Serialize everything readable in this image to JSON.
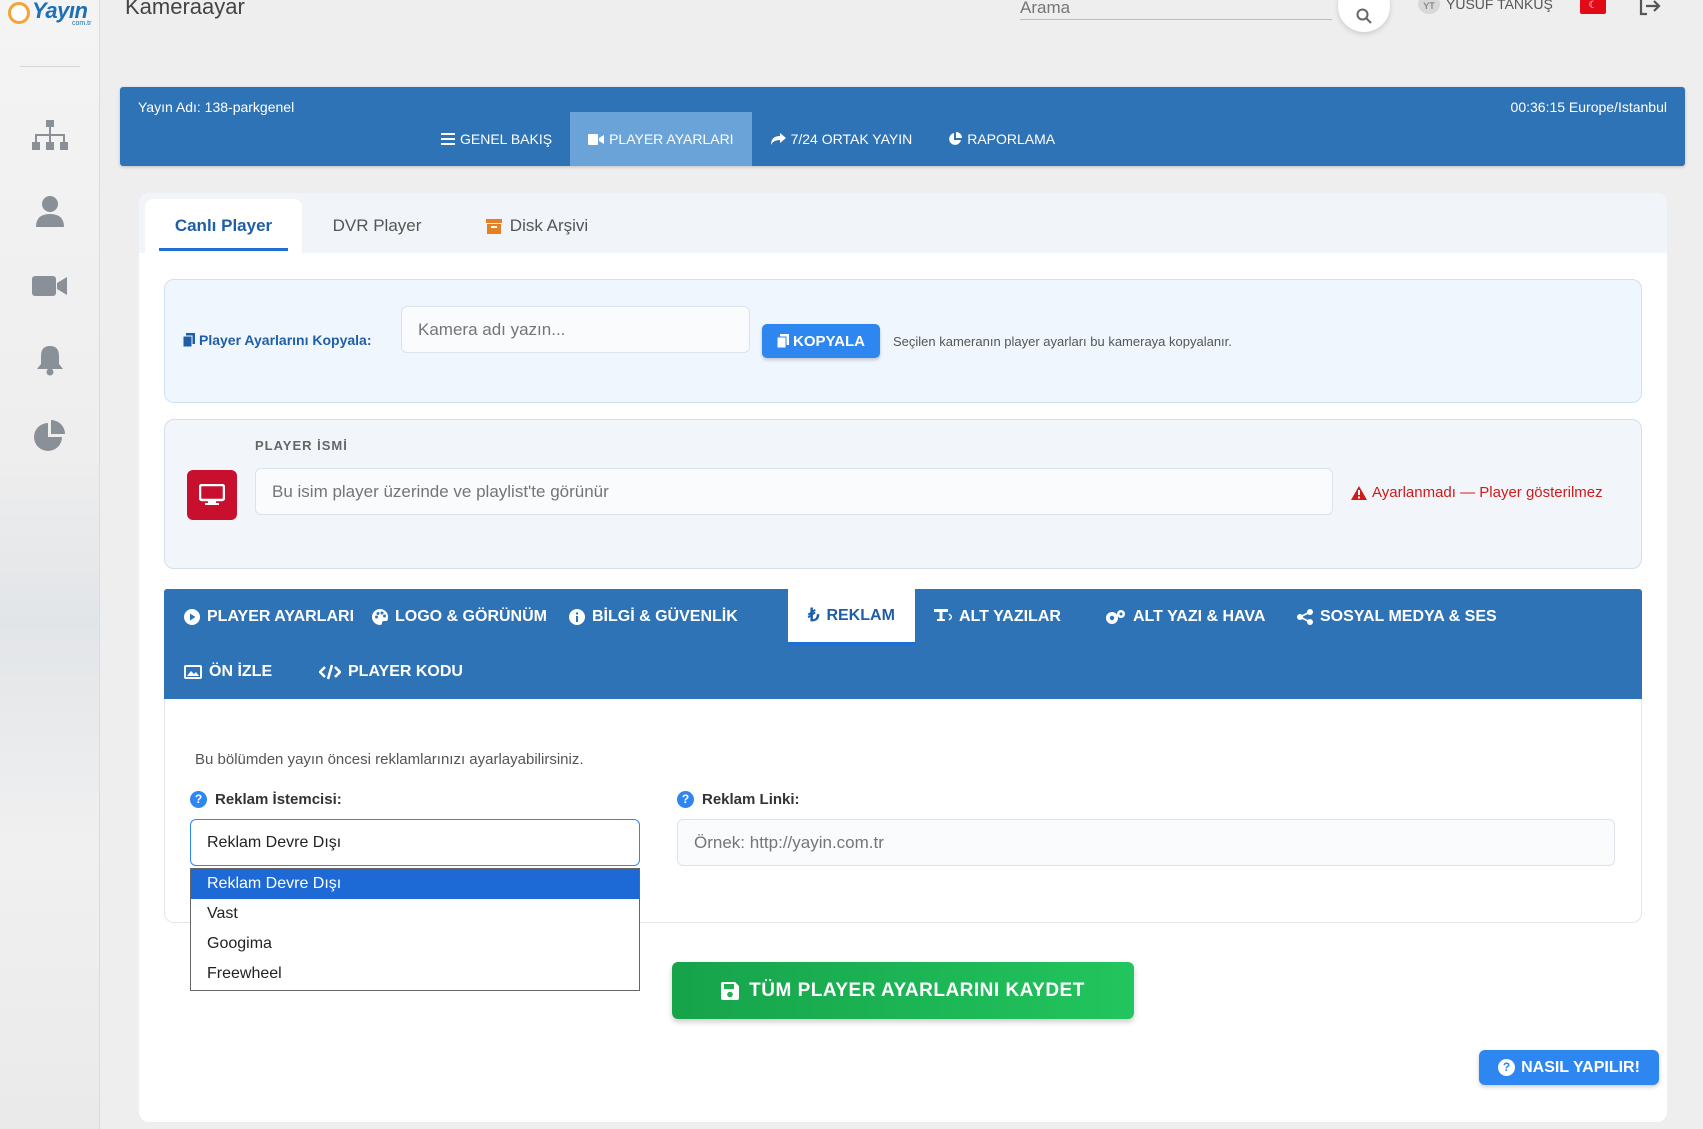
{
  "brand": {
    "name": "Yayın",
    "sub": "com.tr"
  },
  "header": {
    "title": "Kameraayar",
    "search_placeholder": "Arama",
    "avatar_initials": "YT",
    "user_name": "YUSUF TANKUŞ"
  },
  "stream": {
    "name": "Yayın Adı: 138-parkgenel",
    "time": "00:36:15 Europe/Istanbul"
  },
  "topnav": [
    "GENEL BAKIŞ",
    "PLAYER AYARLARI",
    "7/24 ORTAK YAYIN",
    "RAPORLAMA"
  ],
  "player_tabs": [
    "Canlı Player",
    "DVR Player",
    "Disk Arşivi"
  ],
  "copy": {
    "label": "Player Ayarlarını Kopyala:",
    "placeholder": "Kamera adı yazın...",
    "button": "KOPYALA",
    "help": "Seçilen kameranın player ayarları bu kameraya kopyalanır."
  },
  "player_name": {
    "label": "PLAYER İSMİ",
    "placeholder": "Bu isim player üzerinde ve playlist'te görünür",
    "warning": "Ayarlanmadı — Player gösterilmez"
  },
  "settings_tabs": [
    "PLAYER AYARLARI",
    "LOGO & GÖRÜNÜM",
    "BİLGİ & GÜVENLİK",
    "REKLAM",
    "ALT YAZILAR",
    "ALT YAZI & HAVA",
    "SOSYAL MEDYA & SES",
    "ÖN İZLE",
    "PLAYER KODU"
  ],
  "ads": {
    "description": "Bu bölümden yayın öncesi reklamlarınızı ayarlayabilirsiniz.",
    "client_label": "Reklam İstemcisi:",
    "client_value": "Reklam Devre Dışı",
    "client_options": [
      "Reklam Devre Dışı",
      "Vast",
      "Googima",
      "Freewheel"
    ],
    "link_label": "Reklam Linki:",
    "link_placeholder": "Örnek: http://yayin.com.tr"
  },
  "save_button": "TÜM PLAYER AYARLARINI KAYDET",
  "help_button": "NASIL YAPILIR!",
  "colors": {
    "primary_blue": "#2f73b7",
    "accent_blue": "#2e86f0",
    "success_green": "#22c55e",
    "danger_red": "#d11a1a"
  }
}
